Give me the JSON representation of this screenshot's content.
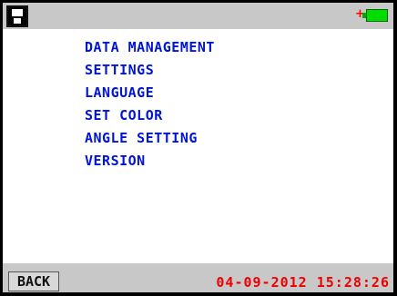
{
  "header": {
    "save_icon": "floppy-disk-icon",
    "battery_icon": "battery-full-icon",
    "battery_plus": "+",
    "battery_level": 1.0
  },
  "menu": {
    "items": [
      {
        "label": "DATA MANAGEMENT"
      },
      {
        "label": "SETTINGS"
      },
      {
        "label": "LANGUAGE"
      },
      {
        "label": "SET COLOR"
      },
      {
        "label": "ANGLE SETTING"
      },
      {
        "label": "VERSION"
      }
    ]
  },
  "footer": {
    "back_label": "BACK",
    "datetime": "04-09-2012 15:28:26"
  },
  "colors": {
    "menu_text": "#0014d6",
    "datetime_text": "#ee0000",
    "battery": "#00dd00"
  }
}
